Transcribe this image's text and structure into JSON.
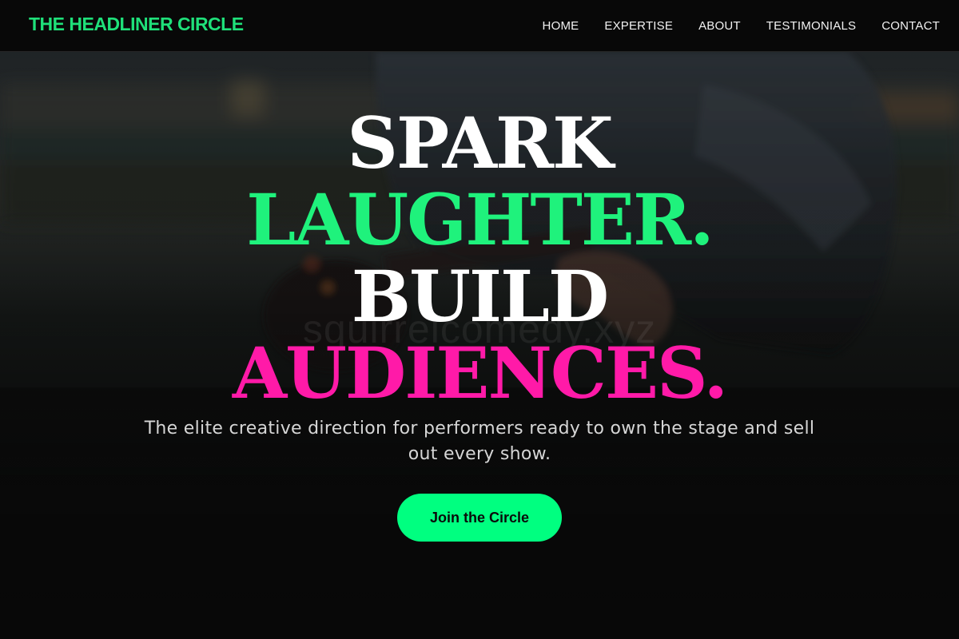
{
  "brand": {
    "name": "THE HEADLINER CIRCLE",
    "accent": "#1fe07a"
  },
  "nav": {
    "items": [
      {
        "label": "HOME"
      },
      {
        "label": "EXPERTISE"
      },
      {
        "label": "ABOUT"
      },
      {
        "label": "TESTIMONIALS"
      },
      {
        "label": "CONTACT"
      }
    ]
  },
  "hero": {
    "headline": [
      {
        "text": "SPARK",
        "color": "#ffffff"
      },
      {
        "text": "LAUGHTER.",
        "color": "#1ff27c"
      },
      {
        "text": "BUILD",
        "color": "#ffffff"
      },
      {
        "text": "AUDIENCES.",
        "color": "#ff1aa8"
      }
    ],
    "subtitle": "The elite creative direction for performers ready to own the stage and sell out every show.",
    "cta_label": "Join the Circle",
    "cta_color": "#00ff80",
    "watermark": "squirrelcomedy.xyz",
    "background_image": "blurred photo of a person in a denim jacket holding a guitar against a dusky skyline"
  }
}
